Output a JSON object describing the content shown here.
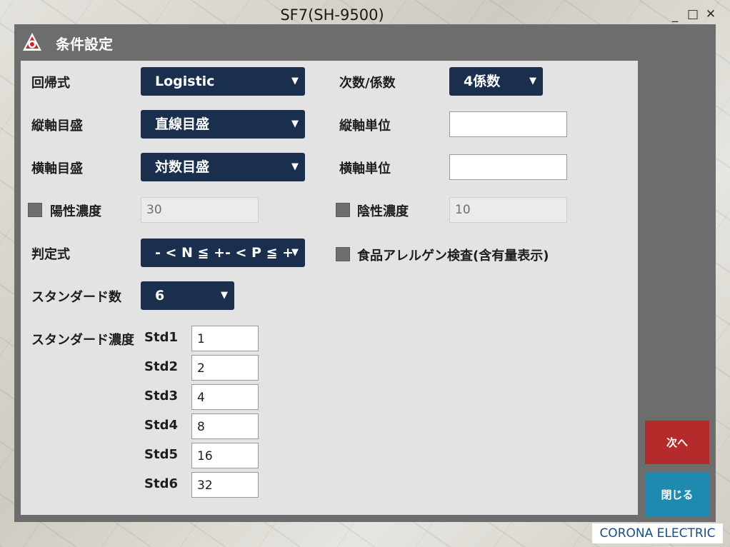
{
  "window": {
    "title": "SF7(SH-9500)",
    "controls": {
      "minimize": "_",
      "maximize": "□",
      "close": "✕"
    }
  },
  "dialog": {
    "title": "条件設定",
    "logo_icon": "corona-logo-icon"
  },
  "form": {
    "regression": {
      "label": "回帰式",
      "value": "Logistic"
    },
    "order": {
      "label": "次数/係数",
      "value": "4係数"
    },
    "y_scale": {
      "label": "縦軸目盛",
      "value": "直線目盛"
    },
    "y_unit": {
      "label": "縦軸単位",
      "value": ""
    },
    "x_scale": {
      "label": "横軸目盛",
      "value": "対数目盛"
    },
    "x_unit": {
      "label": "横軸単位",
      "value": ""
    },
    "positive": {
      "label": "陽性濃度",
      "value": "30",
      "checked": false
    },
    "negative": {
      "label": "陰性濃度",
      "value": "10",
      "checked": false
    },
    "judgement": {
      "label": "判定式",
      "value": "- < N ≦ +- < P ≦ +"
    },
    "allergen": {
      "label": "食品アレルゲン検査(含有量表示)",
      "checked": false
    },
    "std_count": {
      "label": "スタンダード数",
      "value": "6"
    },
    "std_conc": {
      "label": "スタンダード濃度"
    },
    "standards": [
      {
        "label": "Std1",
        "value": "1"
      },
      {
        "label": "Std2",
        "value": "2"
      },
      {
        "label": "Std3",
        "value": "4"
      },
      {
        "label": "Std4",
        "value": "8"
      },
      {
        "label": "Std5",
        "value": "16"
      },
      {
        "label": "Std6",
        "value": "32"
      }
    ]
  },
  "buttons": {
    "next": "次へ",
    "close": "閉じる"
  },
  "brand": "CORONA ELECTRIC",
  "colors": {
    "select_bg": "#1a2e4d",
    "next_btn": "#b52a2a",
    "close_btn": "#1f8ab0",
    "dialog_frame": "#6d6d6d",
    "panel": "#e3e3e3"
  }
}
